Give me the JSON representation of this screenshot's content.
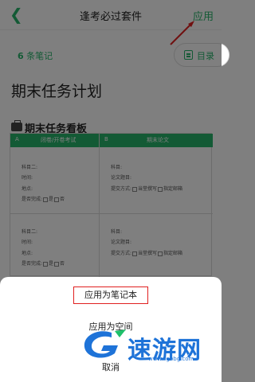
{
  "header": {
    "back_icon": "chevron-left-icon",
    "title": "逢考必过套件",
    "apply_label": "应用"
  },
  "notes": {
    "count": "6",
    "count_suffix": "条笔记",
    "toc_label": "目录"
  },
  "document": {
    "title": "期末任务计划",
    "board_title": "期末任务看板"
  },
  "table": {
    "header_a_letter": "A",
    "header_a": "闭卷/开卷考试",
    "header_b_letter": "B",
    "header_b": "期末论文",
    "left_rows": [
      [
        "科目二:",
        "时间:",
        "地点:",
        "是否完成:"
      ],
      [
        "科目二:",
        "时间:",
        "地点:",
        "是否完成:"
      ]
    ],
    "right_rows": [
      [
        "科目:",
        "论文题目:",
        "提交方式:"
      ],
      [
        "科目:",
        "论文题目:",
        "提交方式:"
      ]
    ],
    "done_yes": "是",
    "done_no": "否",
    "submit_option_1": "当堂撰写",
    "submit_option_2": "指定邮箱"
  },
  "sheet": {
    "option_1": "应用为笔记本",
    "option_2": "应用为空间",
    "cancel": "取消"
  },
  "watermark": {
    "text": "速游网",
    "url": "www.sgbbg.com"
  },
  "colors": {
    "accent": "#27b46a",
    "annotation_red": "#e02020",
    "watermark_blue": "#1e73d8"
  }
}
